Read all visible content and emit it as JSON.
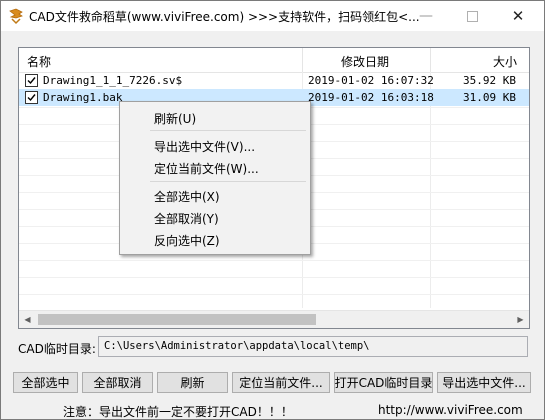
{
  "window": {
    "title": "CAD文件救命稻草(www.viviFree.com) >>>支持软件，扫码领红包<...",
    "minimize_glyph": "—",
    "close_glyph": "✕"
  },
  "list": {
    "columns": [
      "名称",
      "修改日期",
      "大小"
    ],
    "rows": [
      {
        "name": "Drawing1_1_1_7226.sv$",
        "date": "2019-01-02 16:07:32",
        "size": "35.92 KB",
        "checked": true,
        "selected": false
      },
      {
        "name": "Drawing1.bak",
        "date": "2019-01-02 16:03:18",
        "size": "31.09 KB",
        "checked": true,
        "selected": true
      }
    ]
  },
  "context_menu": {
    "refresh": "刷新(U)",
    "export_selected": "导出选中文件(V)...",
    "locate_current": "定位当前文件(W)...",
    "select_all": "全部选中(X)",
    "deselect_all": "全部取消(Y)",
    "invert_selection": "反向选中(Z)"
  },
  "temp_dir": {
    "label": "CAD临时目录:",
    "value": "C:\\Users\\Administrator\\appdata\\local\\temp\\"
  },
  "buttons": {
    "select_all": "全部选中",
    "deselect_all": "全部取消",
    "refresh": "刷新",
    "locate_current": "定位当前文件...",
    "open_temp": "打开CAD临时目录",
    "export_selected": "导出选中文件..."
  },
  "footer": {
    "note": "注意：导出文件前一定不要打开CAD！！！",
    "url": "http://www.viviFree.com"
  }
}
